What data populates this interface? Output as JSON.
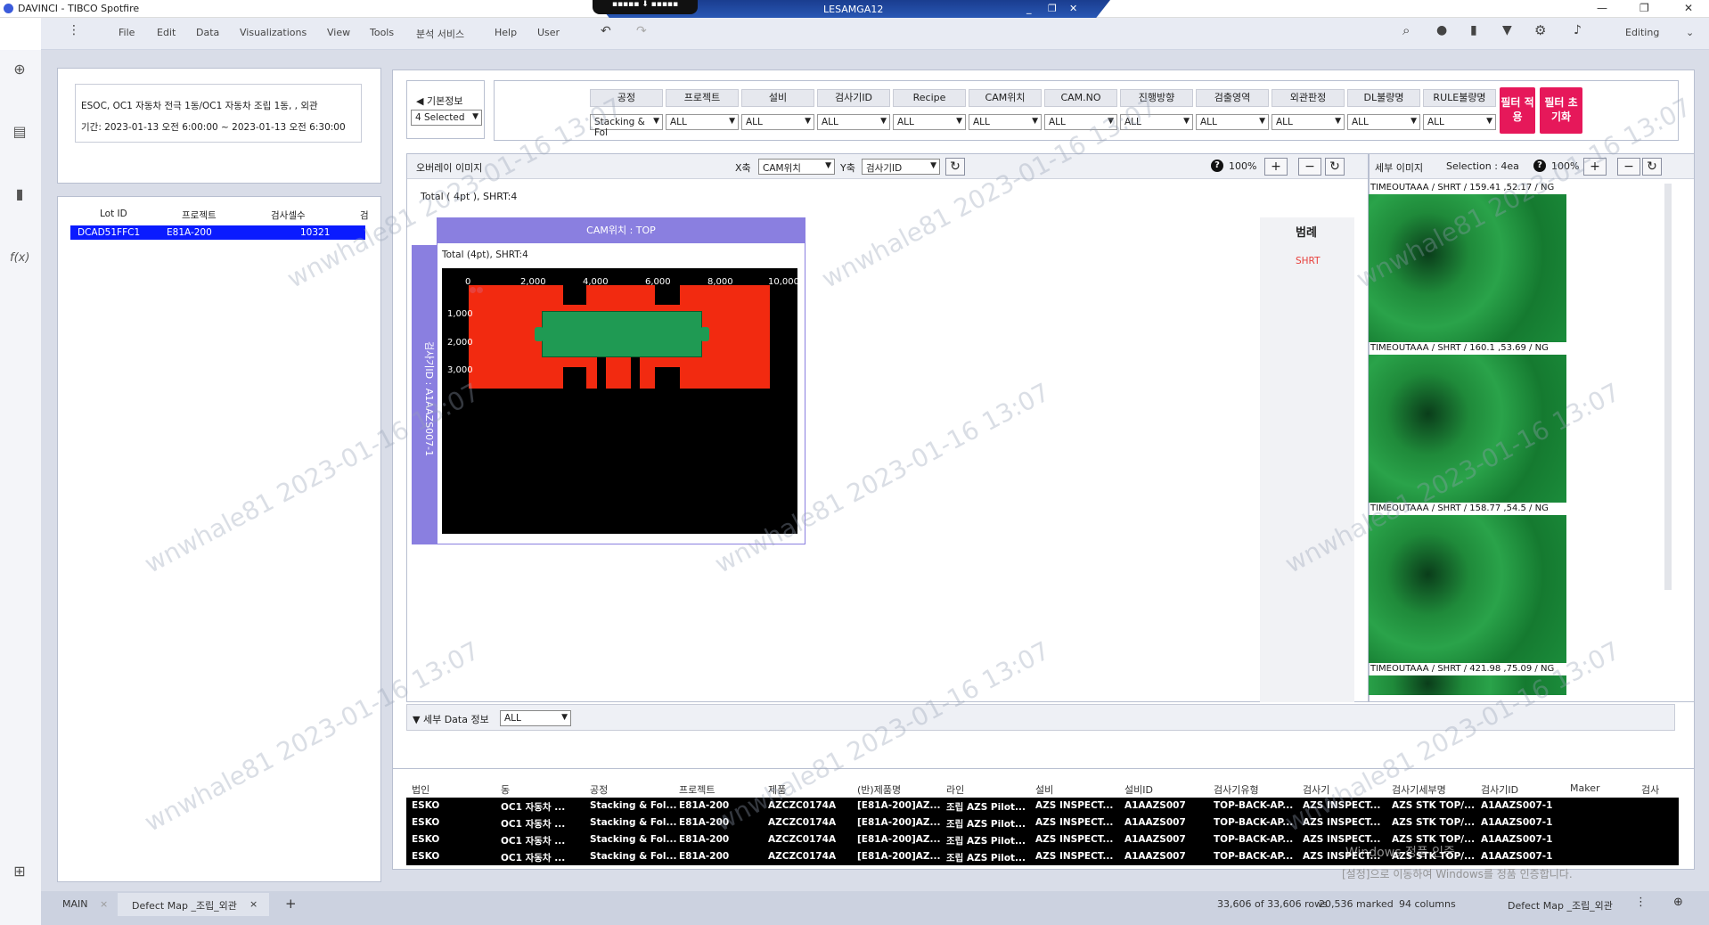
{
  "app": {
    "title": "DAVINCI - TIBCO Spotfire",
    "remote_title": "LESAMGA12",
    "mode": "Editing"
  },
  "menu": [
    "File",
    "Edit",
    "Data",
    "Visualizations",
    "View",
    "Tools",
    "분석 서비스",
    "Help",
    "User"
  ],
  "info": {
    "line1": "ESOC, OC1 자동차 전극 1동/OC1 자동차 조립 1동, , 외관",
    "line2": "기간: 2023-01-13 오전 6:00:00 ~ 2023-01-13 오전 6:30:00"
  },
  "lot_table": {
    "headers": [
      "Lot ID",
      "프로젝트",
      "검사셀수",
      "검"
    ],
    "row": [
      "DCAD51FFC1",
      "E81A-200",
      "10321"
    ]
  },
  "basic": {
    "label": "◀ 기본정보",
    "select": "4 Selected"
  },
  "filters": [
    {
      "label": "공정",
      "value": "Stacking & Fol"
    },
    {
      "label": "프로젝트",
      "value": "ALL"
    },
    {
      "label": "설비",
      "value": "ALL"
    },
    {
      "label": "검사기ID",
      "value": "ALL"
    },
    {
      "label": "Recipe",
      "value": "ALL"
    },
    {
      "label": "CAM위치",
      "value": "ALL"
    },
    {
      "label": "CAM.NO",
      "value": "ALL"
    },
    {
      "label": "진행방향",
      "value": "ALL"
    },
    {
      "label": "검출영역",
      "value": "ALL"
    },
    {
      "label": "외관판정",
      "value": "ALL"
    },
    {
      "label": "DL불량명",
      "value": "ALL"
    },
    {
      "label": "RULE불량명",
      "value": "ALL"
    }
  ],
  "buttons": {
    "apply": "필터 적용",
    "reset": "필터 초기화"
  },
  "overlay": {
    "title": "오버레이 이미지",
    "x_label": "X축",
    "x_value": "CAM위치",
    "y_label": "Y축",
    "y_value": "검사기ID",
    "zoom": "100%",
    "total": "Total ( 4pt ), SHRT:4",
    "plot_header": "CAM위치 : TOP",
    "plot_sub": "Total (4pt), SHRT:4",
    "y_strip": "검사기ID : A1AAZS007-1",
    "x_ticks": [
      "0",
      "2,000",
      "4,000",
      "6,000",
      "8,000",
      "10,000"
    ],
    "y_ticks": [
      "1,000",
      "2,000",
      "3,000"
    ],
    "legend_title": "범례",
    "legend_item": "SHRT",
    "legend_color": "#e8413c"
  },
  "detail": {
    "title": "세부 이미지",
    "selection": "Selection : 4ea",
    "zoom": "100%",
    "captions": [
      "TIMEOUTAAA / SHRT / 159.41 ,52.17 / NG",
      "TIMEOUTAAA / SHRT / 160.1 ,53.69 / NG",
      "TIMEOUTAAA / SHRT / 158.77 ,54.5 / NG",
      "TIMEOUTAAA / SHRT / 421.98 ,75.09 / NG"
    ]
  },
  "data_info": {
    "label": "▼ 세부 Data 정보",
    "value": "ALL"
  },
  "table": {
    "headers": [
      "법인",
      "동",
      "공정",
      "프로젝트",
      "제품",
      "(반)제품명",
      "라인",
      "설비",
      "설비ID",
      "검사기유형",
      "검사기",
      "검사기세부명",
      "검사기ID",
      "Maker",
      "검사"
    ],
    "rows": [
      [
        "ESKO",
        "OC1 자동차 ...",
        "Stacking & Fol...",
        "E81A-200",
        "AZCZC0174A",
        "[E81A-200]AZ...",
        "조립 AZS Pilot...",
        "AZS INSPECT...",
        "A1AAZS007",
        "TOP-BACK-AP...",
        "AZS INSPECT...",
        "AZS STK TOP/...",
        "A1AAZS007-1"
      ],
      [
        "ESKO",
        "OC1 자동차 ...",
        "Stacking & Fol...",
        "E81A-200",
        "AZCZC0174A",
        "[E81A-200]AZ...",
        "조립 AZS Pilot...",
        "AZS INSPECT...",
        "A1AAZS007",
        "TOP-BACK-AP...",
        "AZS INSPECT...",
        "AZS STK TOP/...",
        "A1AAZS007-1"
      ],
      [
        "ESKO",
        "OC1 자동차 ...",
        "Stacking & Fol...",
        "E81A-200",
        "AZCZC0174A",
        "[E81A-200]AZ...",
        "조립 AZS Pilot...",
        "AZS INSPECT...",
        "A1AAZS007",
        "TOP-BACK-AP...",
        "AZS INSPECT...",
        "AZS STK TOP/...",
        "A1AAZS007-1"
      ],
      [
        "ESKO",
        "OC1 자동차 ...",
        "Stacking & Fol...",
        "E81A-200",
        "AZCZC0174A",
        "[E81A-200]AZ...",
        "조립 AZS Pilot...",
        "AZS INSPECT...",
        "A1AAZS007",
        "TOP-BACK-AP...",
        "AZS INSPECT...",
        "AZS STK TOP/...",
        "A1AAZS007-1"
      ]
    ]
  },
  "status": {
    "tab_main": "MAIN",
    "tab_defect": "Defect Map _조립_외관",
    "rows": "33,606 of 33,606 rows",
    "marked": "20,536 marked",
    "columns": "94 columns",
    "page": "Defect Map _조립_외관"
  },
  "windows_notice": {
    "line1": "Windows 정품 인증",
    "line2": "[설정]으로 이동하여 Windows를 정품 인증합니다."
  },
  "watermark": "wnwhale81 2023-01-16 13:07"
}
